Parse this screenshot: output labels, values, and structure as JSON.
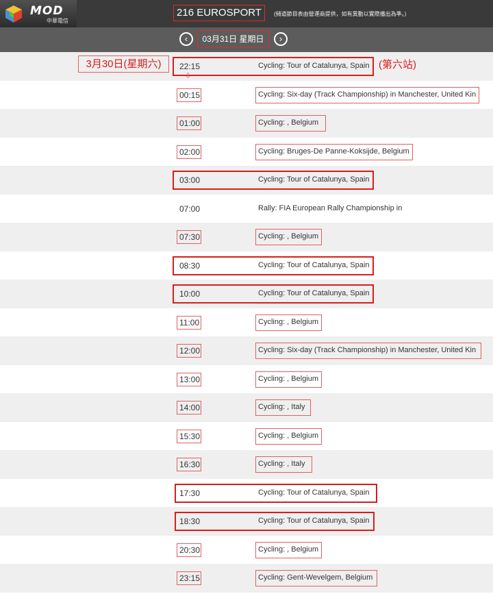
{
  "header": {
    "logo_text": "MOD",
    "logo_sub": "中華電信",
    "channel": "216 EUROSPORT",
    "note": "(頻道節目表由營運商提供，如有異動以實際播出為準。)"
  },
  "datebar": {
    "prev_icon": "‹",
    "next_icon": "›",
    "date_num": "03月31日",
    "weekday": "星期日"
  },
  "annotations": {
    "prev_date": "3月30日(星期六)",
    "stage": "(第六站)",
    "arrow": "⇩"
  },
  "schedule": [
    {
      "time": "22:15",
      "title": "Cycling: Tour of Catalunya, Spain"
    },
    {
      "time": "00:15",
      "title": "Cycling: Six-day (Track Championship) in Manchester, United Kin"
    },
    {
      "time": "01:00",
      "title": "Cycling: , Belgium"
    },
    {
      "time": "02:00",
      "title": "Cycling: Bruges-De Panne-Koksijde, Belgium"
    },
    {
      "time": "03:00",
      "title": "Cycling: Tour of Catalunya, Spain"
    },
    {
      "time": "07:00",
      "title": "Rally: FIA European Rally Championship in"
    },
    {
      "time": "07:30",
      "title": "Cycling: , Belgium"
    },
    {
      "time": "08:30",
      "title": "Cycling: Tour of Catalunya, Spain"
    },
    {
      "time": "10:00",
      "title": "Cycling: Tour of Catalunya, Spain"
    },
    {
      "time": "11:00",
      "title": "Cycling: , Belgium"
    },
    {
      "time": "12:00",
      "title": "Cycling: Six-day (Track Championship) in Manchester, United Kin"
    },
    {
      "time": "13:00",
      "title": "Cycling: , Belgium"
    },
    {
      "time": "14:00",
      "title": "Cycling: , Italy"
    },
    {
      "time": "15:30",
      "title": "Cycling: , Belgium"
    },
    {
      "time": "16:30",
      "title": "Cycling: , Italy"
    },
    {
      "time": "17:30",
      "title": "Cycling: Tour of Catalunya, Spain"
    },
    {
      "time": "18:30",
      "title": "Cycling: Tour of Catalunya, Spain"
    },
    {
      "time": "20:30",
      "title": "Cycling: , Belgium"
    },
    {
      "time": "23:15",
      "title": "Cycling: Gent-Wevelgem, Belgium"
    }
  ]
}
